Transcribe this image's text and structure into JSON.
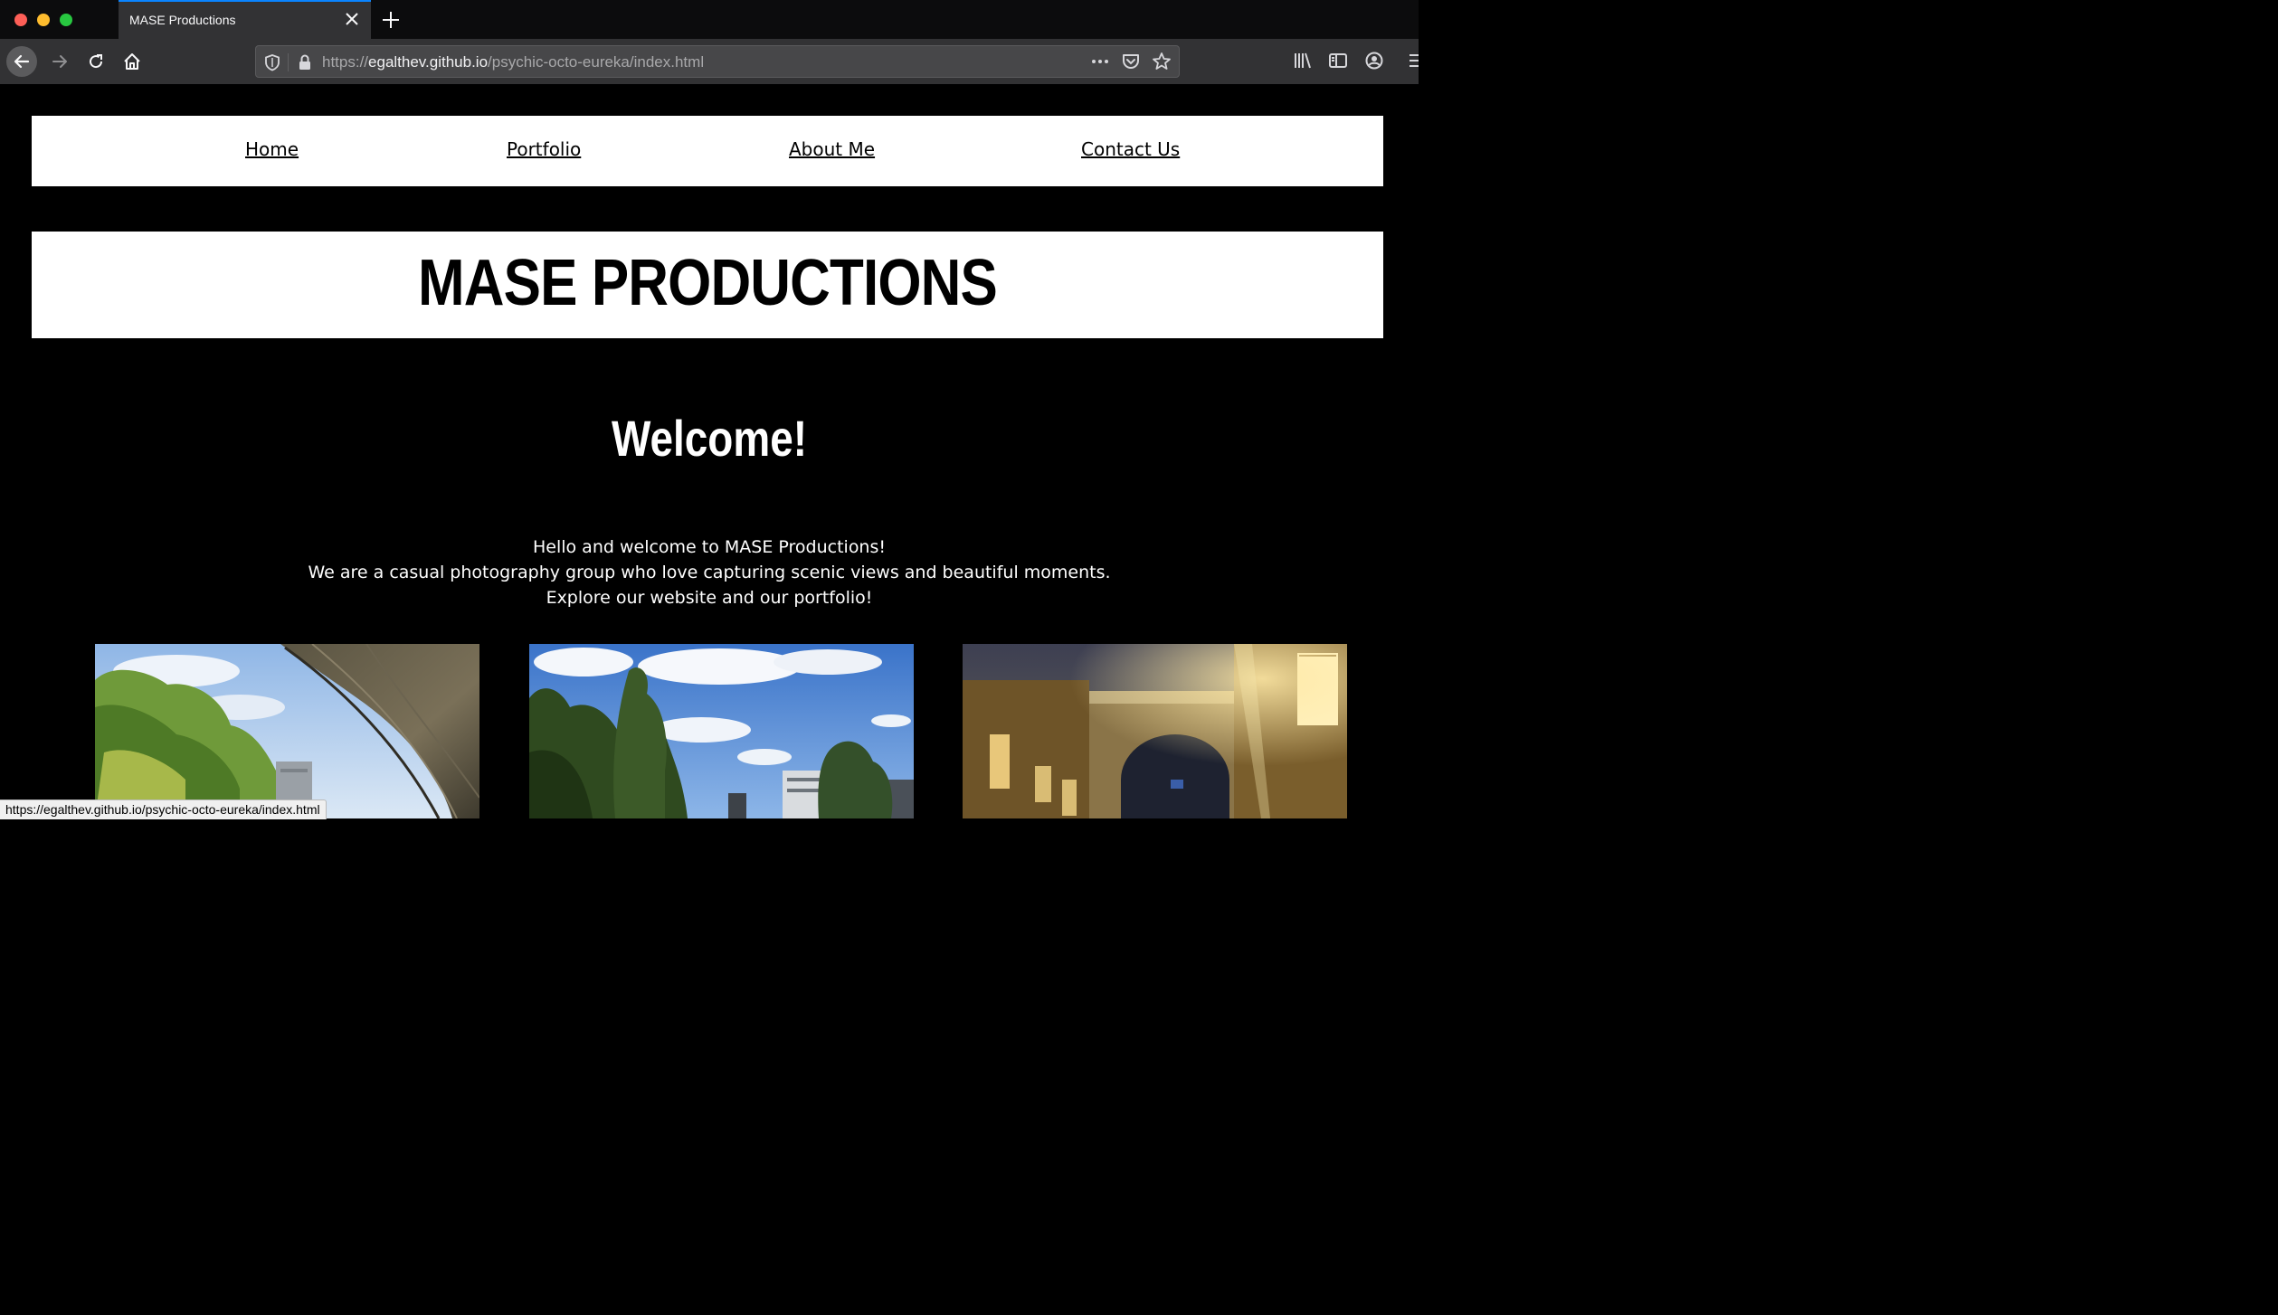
{
  "browser": {
    "tab_title": "MASE Productions",
    "url_prefix": "https://",
    "url_host": "egalthev.github.io",
    "url_path": "/psychic-octo-eureka/index.html",
    "status_url": "https://egalthev.github.io/psychic-octo-eureka/index.html"
  },
  "site": {
    "nav": [
      "Home",
      "Portfolio",
      "About Me",
      "Contact Us"
    ],
    "title": "MASE PRODUCTIONS",
    "welcome": "Welcome!",
    "intro": [
      "Hello and welcome to MASE Productions!",
      "We are a casual photography group who love capturing scenic views and beautiful moments.",
      "Explore our website and our portfolio!"
    ]
  },
  "colors": {
    "page_bg": "#000000",
    "panel_bg": "#ffffff",
    "chrome_dark": "#0c0c0d",
    "chrome_toolbar": "#323234",
    "tab_accent": "#0a84ff"
  }
}
